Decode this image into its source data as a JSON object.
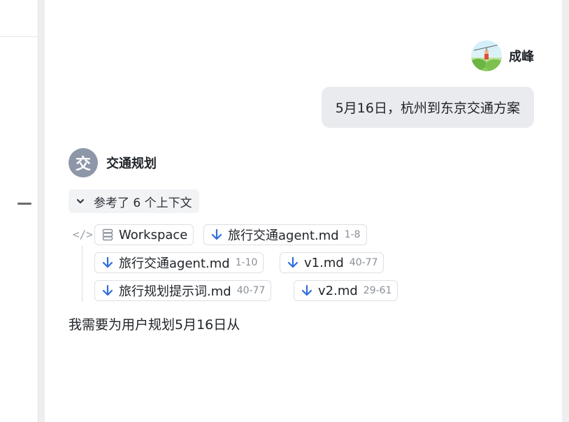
{
  "user": {
    "name": "成峰"
  },
  "user_message": "5月16日，杭州到东京交通方案",
  "bot": {
    "avatar_char": "交",
    "name": "交通规划"
  },
  "context": {
    "toggle_label": "参考了 6 个上下文",
    "chips": [
      {
        "icon": "database-icon",
        "label": "Workspace",
        "range": ""
      },
      {
        "icon": "arrow-down-icon",
        "label": "旅行交通agent.md",
        "range": "1-8"
      },
      {
        "icon": "arrow-down-icon",
        "label": "旅行交通agent.md",
        "range": "1-10"
      },
      {
        "icon": "arrow-down-icon",
        "label": "v1.md",
        "range": "40-77"
      },
      {
        "icon": "arrow-down-icon",
        "label": "旅行规划提示词.md",
        "range": "40-77"
      },
      {
        "icon": "arrow-down-icon",
        "label": "v2.md",
        "range": "29-61"
      }
    ]
  },
  "answer_text": "我需要为用户规划5月16日从",
  "colors": {
    "accent_blue": "#2f6fdd",
    "bubble_bg": "#e9ebef",
    "bot_avatar": "#8e97a8"
  }
}
